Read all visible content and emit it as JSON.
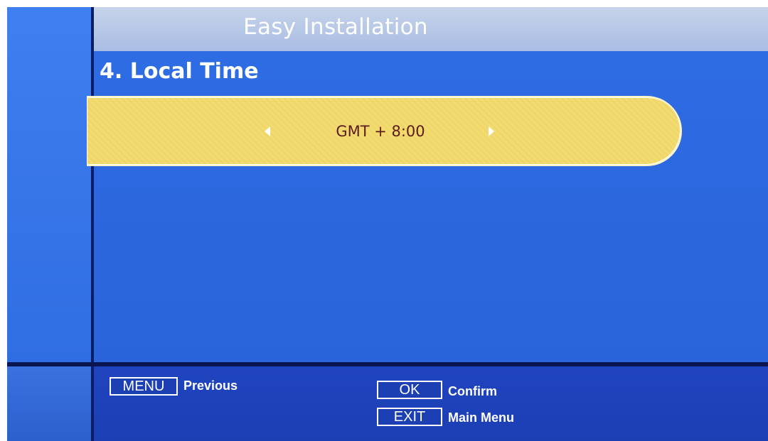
{
  "header": {
    "title": "Easy Installation"
  },
  "step": {
    "title": "4. Local Time"
  },
  "selector": {
    "value": "GMT + 8:00",
    "left_arrow_icon": "triangle-left",
    "right_arrow_icon": "triangle-right"
  },
  "footer": {
    "menu_key": "MENU",
    "menu_label": "Previous",
    "ok_key": "OK",
    "ok_label": "Confirm",
    "exit_key": "EXIT",
    "exit_label": "Main Menu"
  },
  "colors": {
    "background_blue": "#2c67de",
    "title_bar": "#b6c7e7",
    "highlight_yellow": "#f0d96d",
    "footer_blue": "#1c3fb4",
    "value_text": "#5a1c1c"
  }
}
